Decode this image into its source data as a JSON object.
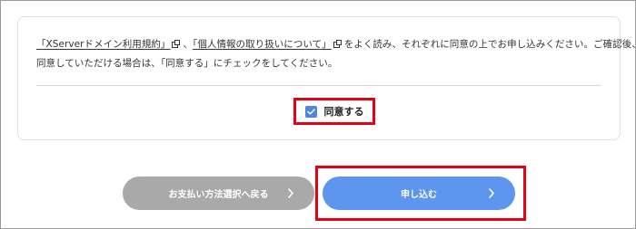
{
  "terms": {
    "link1_text": "「XServerドメイン利用規約」",
    "separator": "、",
    "link2_text": "「個人情報の取り扱いについて」",
    "line1_suffix": "をよく読み、それぞれに同意の上でお申し込みください。ご確認後、",
    "line2_text": "同意していただける場合は、「同意する」にチェックをしてください。",
    "link_icon": "external-link-icon"
  },
  "agreement": {
    "checked": true,
    "label": "同意する",
    "checkbox_color": "#4e86dc",
    "highlight_color": "#e60012"
  },
  "actions": {
    "back_label": "お支払い方法選択へ戻る",
    "submit_label": "申し込む",
    "back_color": "#a9a9a9",
    "submit_color": "#5d95ef",
    "chevron_icon": "chevron-right-icon"
  }
}
